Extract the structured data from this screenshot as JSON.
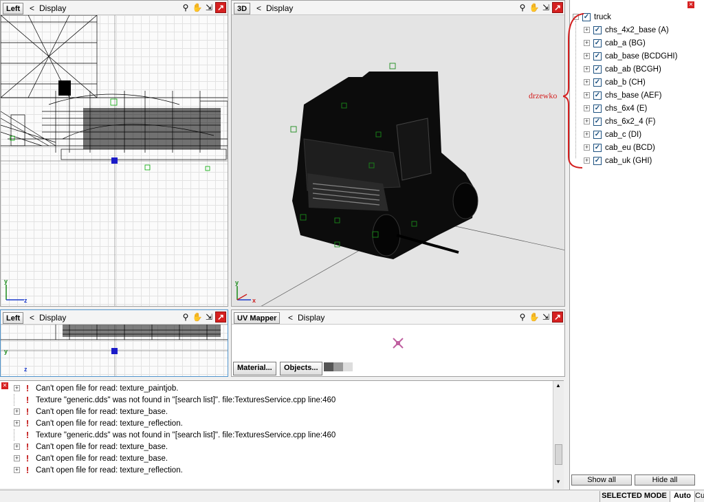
{
  "viewports": {
    "left_top": {
      "name": "Left",
      "display_label": "Display",
      "axis_y": "y",
      "axis_z": "z"
    },
    "threed": {
      "name": "3D",
      "display_label": "Display",
      "axis_y": "y",
      "axis_x": "x"
    },
    "left_bottom": {
      "name": "Left",
      "display_label": "Display",
      "axis_y": "y",
      "axis_z": "z"
    },
    "uv": {
      "name": "UV Mapper",
      "display_label": "Display",
      "material_btn": "Material...",
      "objects_btn": "Objects..."
    },
    "back_arrow": "<"
  },
  "tree": {
    "root": "truck",
    "items": [
      {
        "label": "chs_4x2_base (A)"
      },
      {
        "label": "cab_a (BG)"
      },
      {
        "label": "cab_base (BCDGHI)"
      },
      {
        "label": "cab_ab (BCGH)"
      },
      {
        "label": "cab_b (CH)"
      },
      {
        "label": "chs_base (AEF)"
      },
      {
        "label": "chs_6x4 (E)"
      },
      {
        "label": "chs_6x2_4 (F)"
      },
      {
        "label": "cab_c (DI)"
      },
      {
        "label": "cab_eu (BCD)"
      },
      {
        "label": "cab_uk (GHI)"
      }
    ],
    "annotation": "drzewko",
    "show_all": "Show all",
    "hide_all": "Hide all"
  },
  "log": {
    "rows": [
      {
        "text": "Can't open file for read: texture_paintjob.",
        "expandable": true
      },
      {
        "text": "Texture \"generic.dds\" was not found in \"[search list]\". file:TexturesService.cpp line:460",
        "expandable": false
      },
      {
        "text": "Can't open file for read: texture_base.",
        "expandable": true
      },
      {
        "text": "Can't open file for read: texture_reflection.",
        "expandable": true
      },
      {
        "text": "Texture \"generic.dds\" was not found in \"[search list]\". file:TexturesService.cpp line:460",
        "expandable": false
      },
      {
        "text": "Can't open file for read: texture_base.",
        "expandable": true
      },
      {
        "text": "Can't open file for read: texture_base.",
        "expandable": true
      },
      {
        "text": "Can't open file for read: texture_reflection.",
        "expandable": true
      }
    ]
  },
  "status": {
    "mode": "SELECTED MODE",
    "auto": "Auto",
    "extra": "Cu"
  },
  "colors": {
    "annotation_red": "#d42020",
    "active_border": "#4f94cd"
  }
}
